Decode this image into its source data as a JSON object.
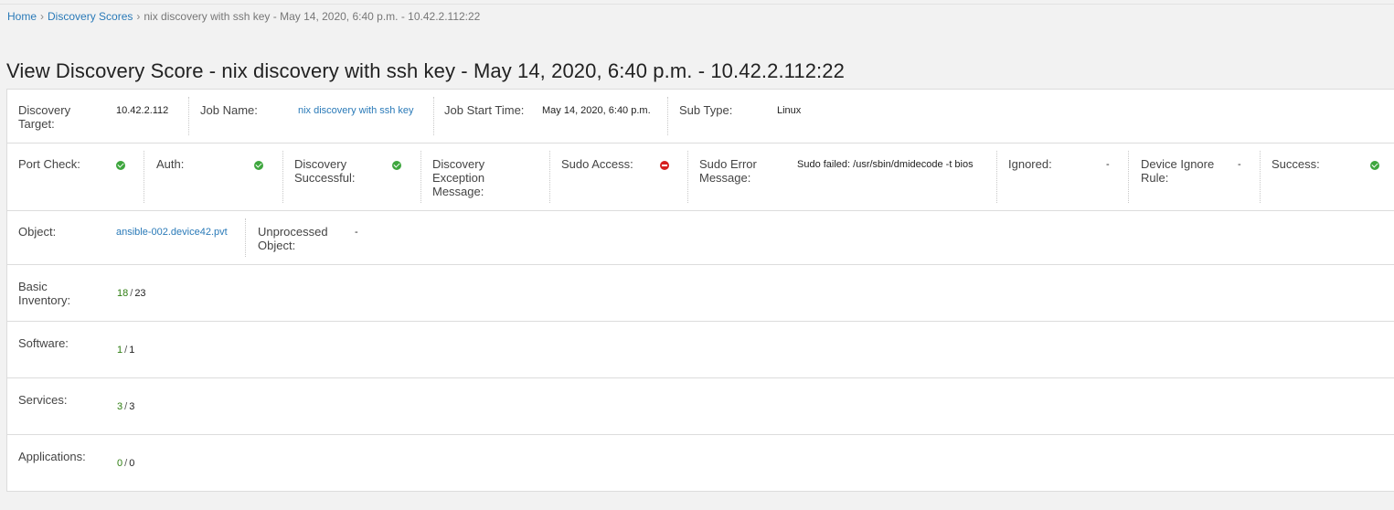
{
  "breadcrumb": {
    "home": "Home",
    "section": "Discovery Scores",
    "current": "nix discovery with ssh key - May 14, 2020, 6:40 p.m. - 10.42.2.112:22",
    "separator": "›"
  },
  "page_title": "View Discovery Score - nix discovery with ssh key - May 14, 2020, 6:40 p.m. - 10.42.2.112:22",
  "row1": {
    "discovery_target": {
      "label": "Discovery Target:",
      "value": "10.42.2.112"
    },
    "job_name": {
      "label": "Job Name:",
      "value": "nix discovery with ssh key"
    },
    "job_start_time": {
      "label": "Job Start Time:",
      "value": "May 14, 2020, 6:40 p.m."
    },
    "sub_type": {
      "label": "Sub Type:",
      "value": "Linux"
    }
  },
  "row2": {
    "port_check": {
      "label": "Port Check:",
      "status": "success"
    },
    "auth": {
      "label": "Auth:",
      "status": "success"
    },
    "discovery_successful": {
      "label": "Discovery Successful:",
      "status": "success"
    },
    "discovery_exception": {
      "label": "Discovery Exception Message:",
      "value": ""
    },
    "sudo_access": {
      "label": "Sudo Access:",
      "status": "error"
    },
    "sudo_error": {
      "label": "Sudo Error Message:",
      "value": "Sudo failed: /usr/sbin/dmidecode -t bios"
    },
    "ignored": {
      "label": "Ignored:",
      "value": "-"
    },
    "device_ignore_rule": {
      "label": "Device Ignore Rule:",
      "value": "-"
    },
    "success": {
      "label": "Success:",
      "status": "success"
    }
  },
  "row3": {
    "object": {
      "label": "Object:",
      "value": "ansible-002.device42.pvt"
    },
    "unprocessed_object": {
      "label": "Unprocessed Object:",
      "value": "-"
    }
  },
  "scores": [
    {
      "label": "Basic Inventory:",
      "num": "18",
      "den": "23"
    },
    {
      "label": "Software:",
      "num": "1",
      "den": "1"
    },
    {
      "label": "Services:",
      "num": "3",
      "den": "3"
    },
    {
      "label": "Applications:",
      "num": "0",
      "den": "0"
    }
  ],
  "colors": {
    "success": "#3ea63e",
    "error": "#d61f1f",
    "link": "#2a7ab8",
    "score_num": "#2e7d11"
  }
}
